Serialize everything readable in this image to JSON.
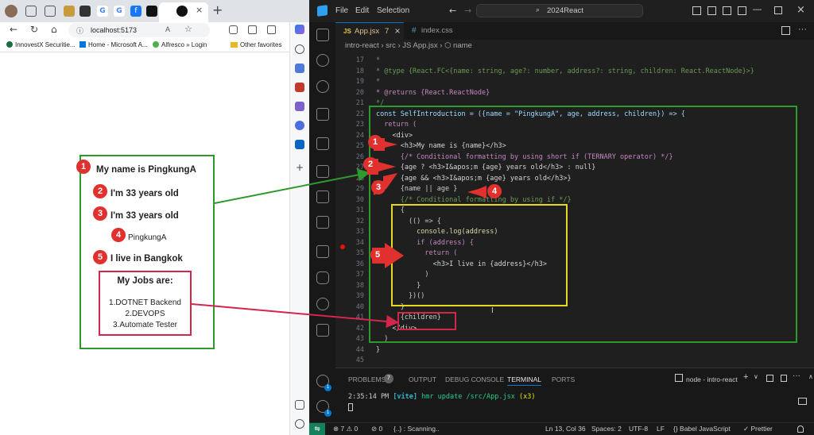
{
  "browser": {
    "tabs": [
      "G",
      "G"
    ],
    "address": "localhost:5173",
    "favorites": [
      "InnovestX Securitie...",
      "Home - Microsoft A...",
      "Alfresco » Login",
      "Other favorites"
    ]
  },
  "page": {
    "name_line": "My name is PingkungA",
    "age_line_1": "I'm 33 years old",
    "age_line_2": "I'm 33 years old",
    "name_fallback": "PingkungA",
    "address_line": "I live in Bangkok",
    "jobs_title": "My Jobs are:",
    "jobs": [
      "1.DOTNET Backend",
      "2.DEVOPS",
      "3.Automate Tester"
    ]
  },
  "badges": [
    "1",
    "2",
    "3",
    "4",
    "5"
  ],
  "vscode": {
    "menu": [
      "File",
      "Edit",
      "Selection"
    ],
    "search": "2024React",
    "tabs": [
      {
        "label": "App.jsx",
        "badge": "7",
        "active": true
      },
      {
        "label": "index.css",
        "active": false
      }
    ],
    "breadcrumb": "intro-react  ›  src  ›  JS App.jsx  ›  ⬡ name",
    "lines": [
      {
        "n": "17",
        "t": "*"
      },
      {
        "n": "18",
        "t": "* @type {React.FC<{name: string, age?: number, address?: string, children: React.ReactNode}>}"
      },
      {
        "n": "19",
        "t": "*"
      },
      {
        "n": "20",
        "t": "* @returns {React.ReactNode}"
      },
      {
        "n": "21",
        "t": "*/"
      },
      {
        "n": "22",
        "t": "const SelfIntroduction = ({name = \"PingkungA\", age, address, children}) => {"
      },
      {
        "n": "23",
        "t": "  return ("
      },
      {
        "n": "24",
        "t": "    <div>"
      },
      {
        "n": "25",
        "t": "      <h3>My name is {name}</h3>"
      },
      {
        "n": "26",
        "t": "      {/* Conditional formatting by using short if (TERNARY operator) */}"
      },
      {
        "n": "27",
        "t": "      {age ? <h3>I&apos;m {age} years old</h3> : null}"
      },
      {
        "n": "28",
        "t": "      {age && <h3>I&apos;m {age} years old</h3>}"
      },
      {
        "n": "29",
        "t": "      {name || age }"
      },
      {
        "n": "30",
        "t": "      {/* Conditional formatting by using if */}"
      },
      {
        "n": "31",
        "t": "      {"
      },
      {
        "n": "32",
        "t": "        (() => {"
      },
      {
        "n": "33",
        "t": "          console.log(address)"
      },
      {
        "n": "34",
        "t": "          if (address) {"
      },
      {
        "n": "35",
        "t": "            return ("
      },
      {
        "n": "36",
        "t": "              <h3>I live in {address}</h3>"
      },
      {
        "n": "37",
        "t": "            )"
      },
      {
        "n": "38",
        "t": "          }"
      },
      {
        "n": "39",
        "t": "        })()"
      },
      {
        "n": "40",
        "t": "      }"
      },
      {
        "n": "41",
        "t": "      {children}"
      },
      {
        "n": "42",
        "t": "    </div>"
      },
      {
        "n": "43",
        "t": "  )"
      },
      {
        "n": "44",
        "t": "}"
      },
      {
        "n": "45",
        "t": ""
      }
    ],
    "panel_tabs": [
      "PROBLEMS",
      "OUTPUT",
      "DEBUG CONSOLE",
      "TERMINAL",
      "PORTS"
    ],
    "problems_count": "7",
    "terminal_name": "node - intro-react",
    "terminal_time": "2:35:14 PM",
    "terminal_tag": "[vite]",
    "terminal_msg": "hmr update /src/App.jsx",
    "terminal_count": "(x3)",
    "status": {
      "errors": "⊗ 7 ⚠ 0",
      "ports": "⊘ 0",
      "scanning": "{..} : Scanning..",
      "position": "Ln 13, Col 36",
      "spaces": "Spaces: 2",
      "encoding": "UTF-8",
      "eol": "LF",
      "language": "{} Babel JavaScript",
      "prettier": "✓ Prettier"
    }
  },
  "colors": {
    "green": "#2e9a2e",
    "red": "#e0312f",
    "yellow": "#e6d820",
    "magenta": "#d6254c",
    "vscode_bg": "#1f1f1f"
  }
}
